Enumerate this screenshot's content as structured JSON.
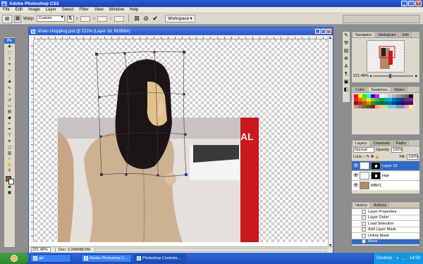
{
  "app": {
    "title": "Adobe Photoshop CS3"
  },
  "menu": [
    "File",
    "Edit",
    "Image",
    "Layer",
    "Select",
    "Filter",
    "View",
    "Window",
    "Help"
  ],
  "options": {
    "warp_label": "Warp:",
    "warp_value": "Custom",
    "workspace_label": "Workspace ▾"
  },
  "document": {
    "title": "shoes shopping.psd @ 221% (Layer 18, RGB/8#)",
    "zoom": "221.48%",
    "doc_info": "Doc: 2.26M/88.5M",
    "partial_sign": "AL"
  },
  "navigator": {
    "tabs": [
      "Navigator",
      "Histogram",
      "Info"
    ],
    "zoom": "221.48%"
  },
  "swatches": {
    "tabs": [
      "Color",
      "Swatches",
      "Styles"
    ],
    "colors": [
      "#ff0000",
      "#ffff00",
      "#00ff00",
      "#00ffff",
      "#0000ff",
      "#ff00ff",
      "#ffffff",
      "#e6e6e6",
      "#cccccc",
      "#b3b3b3",
      "#999999",
      "#808080",
      "#666666",
      "#000000",
      "#ed1c24",
      "#f26522",
      "#f7941d",
      "#fff200",
      "#8dc63f",
      "#39b54a",
      "#00a651",
      "#00a99d",
      "#00aeef",
      "#0072bc",
      "#0054a6",
      "#2e3192",
      "#662d91",
      "#92278f",
      "#9e0039",
      "#a0410d",
      "#a3620a",
      "#aba000",
      "#598527",
      "#197b30",
      "#007236",
      "#00746b",
      "#0076a3",
      "#004a80",
      "#003471",
      "#1b1464",
      "#440e62",
      "#630460",
      "#c69c6d",
      "#a67c52",
      "#8c6239",
      "#754c24",
      "#603813",
      "#f5989d",
      "#fdc689",
      "#c4df9b",
      "#7accc8",
      "#6dcff6",
      "#8393ca",
      "#a186be",
      "#f49ac1",
      "#fff799"
    ]
  },
  "layers": {
    "tabs": [
      "Layers",
      "Channels",
      "Paths"
    ],
    "blend_mode": "Normal",
    "opacity_label": "Opacity:",
    "opacity": "100%",
    "lock_label": "Lock:",
    "fill_label": "Fill:",
    "fill": "100%",
    "items": [
      {
        "name": "Layer 18",
        "active": true,
        "has_mask": true
      },
      {
        "name": "Hair",
        "active": false,
        "has_mask": true
      },
      {
        "name": "MBP1",
        "active": false,
        "has_mask": false
      }
    ]
  },
  "history": {
    "tabs": [
      "History",
      "Actions"
    ],
    "items": [
      {
        "name": "Layer Properties",
        "active": false
      },
      {
        "name": "Layer Order",
        "active": false
      },
      {
        "name": "Load Selection",
        "active": false
      },
      {
        "name": "Add Layer Mask",
        "active": false
      },
      {
        "name": "Unlink Mask",
        "active": false
      },
      {
        "name": "Move",
        "active": true
      }
    ]
  },
  "taskbar": {
    "tasks": [
      "girl",
      "Adobe Photoshop C...",
      "Photoshop Contests..."
    ],
    "desktop_label": "Desktop",
    "clock": "14:59"
  }
}
